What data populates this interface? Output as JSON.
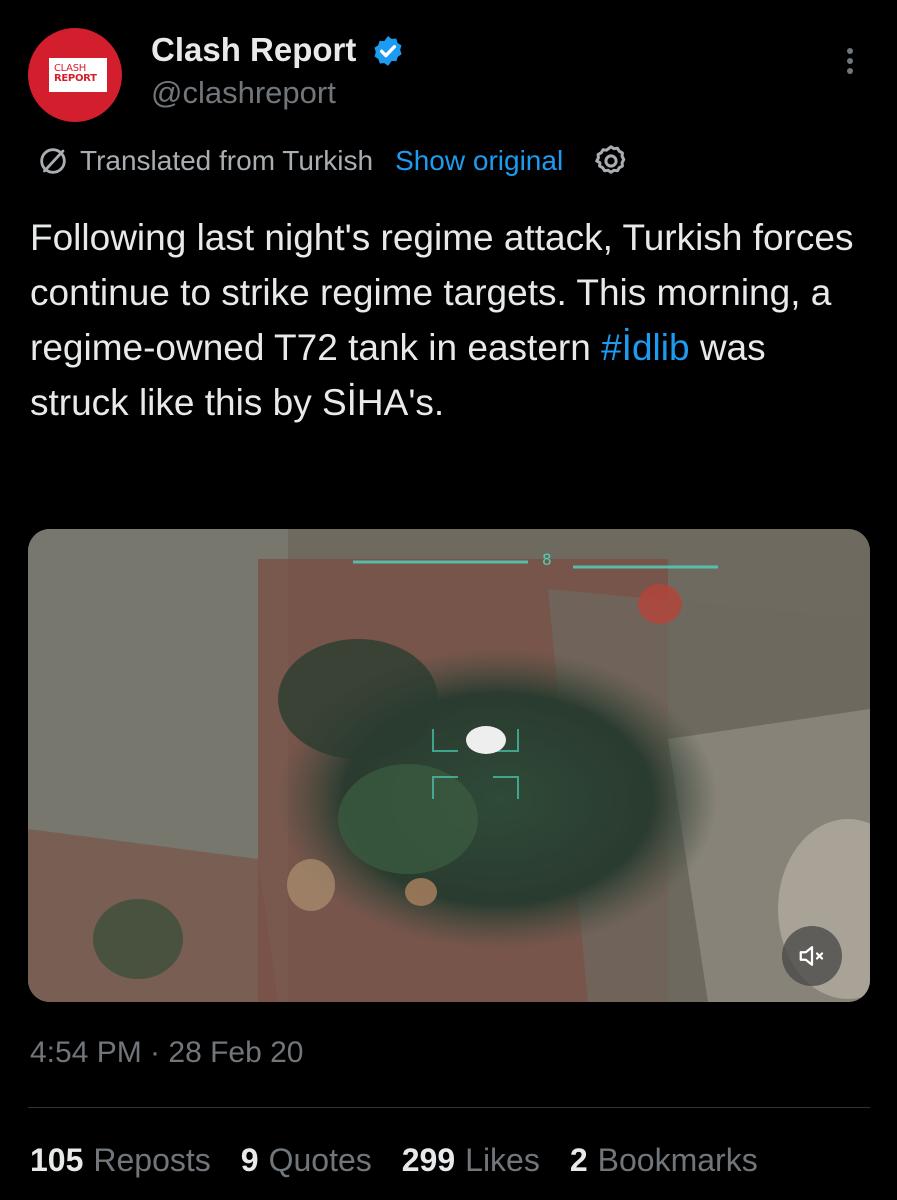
{
  "author": {
    "name": "Clash Report",
    "handle": "@clashreport",
    "avatar_text_top": "CLASH",
    "avatar_text_bottom": "REPORT",
    "verified_color": "#1d9bf0"
  },
  "translation": {
    "label": "Translated from Turkish",
    "show_original": "Show original"
  },
  "tweet": {
    "text_before": "Following last night's regime attack, Turkish forces continue to strike regime targets. This morning, a regime-owned T72 tank in eastern ",
    "hashtag": "#İdlib",
    "text_after": " was struck like this by SİHA's."
  },
  "media": {
    "type": "video",
    "hud_number": "8",
    "mute_icon": "volume-muted-icon"
  },
  "timestamp": "4:54 PM · 28 Feb 20",
  "stats": [
    {
      "count": "105",
      "label": "Reposts"
    },
    {
      "count": "9",
      "label": "Quotes"
    },
    {
      "count": "299",
      "label": "Likes"
    },
    {
      "count": "2",
      "label": "Bookmarks"
    }
  ],
  "colors": {
    "background": "#000000",
    "text": "#e7e9ea",
    "secondary": "#71767b",
    "accent": "#1d9bf0",
    "avatar": "#d31f2d"
  }
}
